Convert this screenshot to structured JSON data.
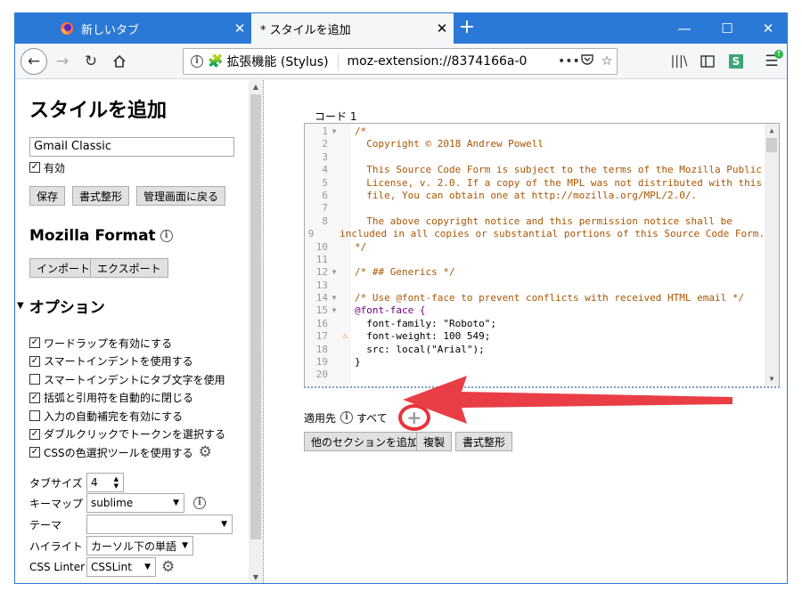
{
  "tabs": [
    {
      "title": "新しいタブ",
      "active": false
    },
    {
      "title": "* スタイルを追加",
      "active": true
    }
  ],
  "toolbar": {
    "identity": "拡張機能 (Stylus)",
    "url": "moz-extension://8374166a-0"
  },
  "sidebar": {
    "title": "スタイルを追加",
    "style_name": "Gmail Classic",
    "enabled_label": "有効",
    "enabled": true,
    "buttons": {
      "save": "保存",
      "beautify": "書式整形",
      "back": "管理画面に戻る"
    },
    "mozilla_format": {
      "heading": "Mozilla Format",
      "import": "インポート",
      "export": "エクスポート"
    },
    "options": {
      "heading": "オプション",
      "items": [
        {
          "label": "ワードラップを有効にする",
          "checked": true
        },
        {
          "label": "スマートインデントを使用する",
          "checked": true
        },
        {
          "label": "スマートインデントにタブ文字を使用",
          "checked": false
        },
        {
          "label": "括弧と引用符を自動的に閉じる",
          "checked": true
        },
        {
          "label": "入力の自動補完を有効にする",
          "checked": false
        },
        {
          "label": "ダブルクリックでトークンを選択する",
          "checked": true
        },
        {
          "label": "CSSの色選択ツールを使用する",
          "checked": true
        }
      ],
      "tab_size_label": "タブサイズ",
      "tab_size": "4",
      "keymap_label": "キーマップ",
      "keymap": "sublime",
      "theme_label": "テーマ",
      "theme": "",
      "highlight_label": "ハイライト",
      "highlight": "カーソル下の単語",
      "linter_label": "CSS Linter",
      "linter": "CSSLint"
    }
  },
  "editor": {
    "section_label": "コード 1",
    "lines": [
      {
        "n": "1",
        "text": "/*"
      },
      {
        "n": "2",
        "text": "  Copyright © 2018 Andrew Powell"
      },
      {
        "n": "3",
        "text": ""
      },
      {
        "n": "4",
        "text": "  This Source Code Form is subject to the terms of the Mozilla Public"
      },
      {
        "n": "5",
        "text": "  License, v. 2.0. If a copy of the MPL was not distributed with this"
      },
      {
        "n": "6",
        "text": "  file, You can obtain one at http://mozilla.org/MPL/2.0/."
      },
      {
        "n": "7",
        "text": ""
      },
      {
        "n": "8",
        "text": "  The above copyright notice and this permission notice shall be"
      },
      {
        "n": "9",
        "text": "  included in all copies or substantial portions of this Source Code Form."
      },
      {
        "n": "10",
        "text": "*/"
      },
      {
        "n": "11",
        "text": ""
      },
      {
        "n": "12",
        "text": "/* ## Generics */"
      },
      {
        "n": "13",
        "text": ""
      },
      {
        "n": "14",
        "text": "/* Use @font-face to prevent conflicts with received HTML email */"
      },
      {
        "n": "15",
        "text": "@font-face {"
      },
      {
        "n": "16",
        "text": "  font-family: \"Roboto\";"
      },
      {
        "n": "17",
        "text": "  font-weight: 100 549;"
      },
      {
        "n": "18",
        "text": "  src: local(\"Arial\");"
      },
      {
        "n": "19",
        "text": "}"
      },
      {
        "n": "20",
        "text": ""
      }
    ],
    "applies_label": "適用先",
    "applies_value": "すべて",
    "buttons": {
      "add_section": "他のセクションを追加",
      "clone": "複製",
      "beautify": "書式整形"
    }
  },
  "colors": {
    "accent": "#2b79d6",
    "highlight_ring": "#e8343c"
  }
}
